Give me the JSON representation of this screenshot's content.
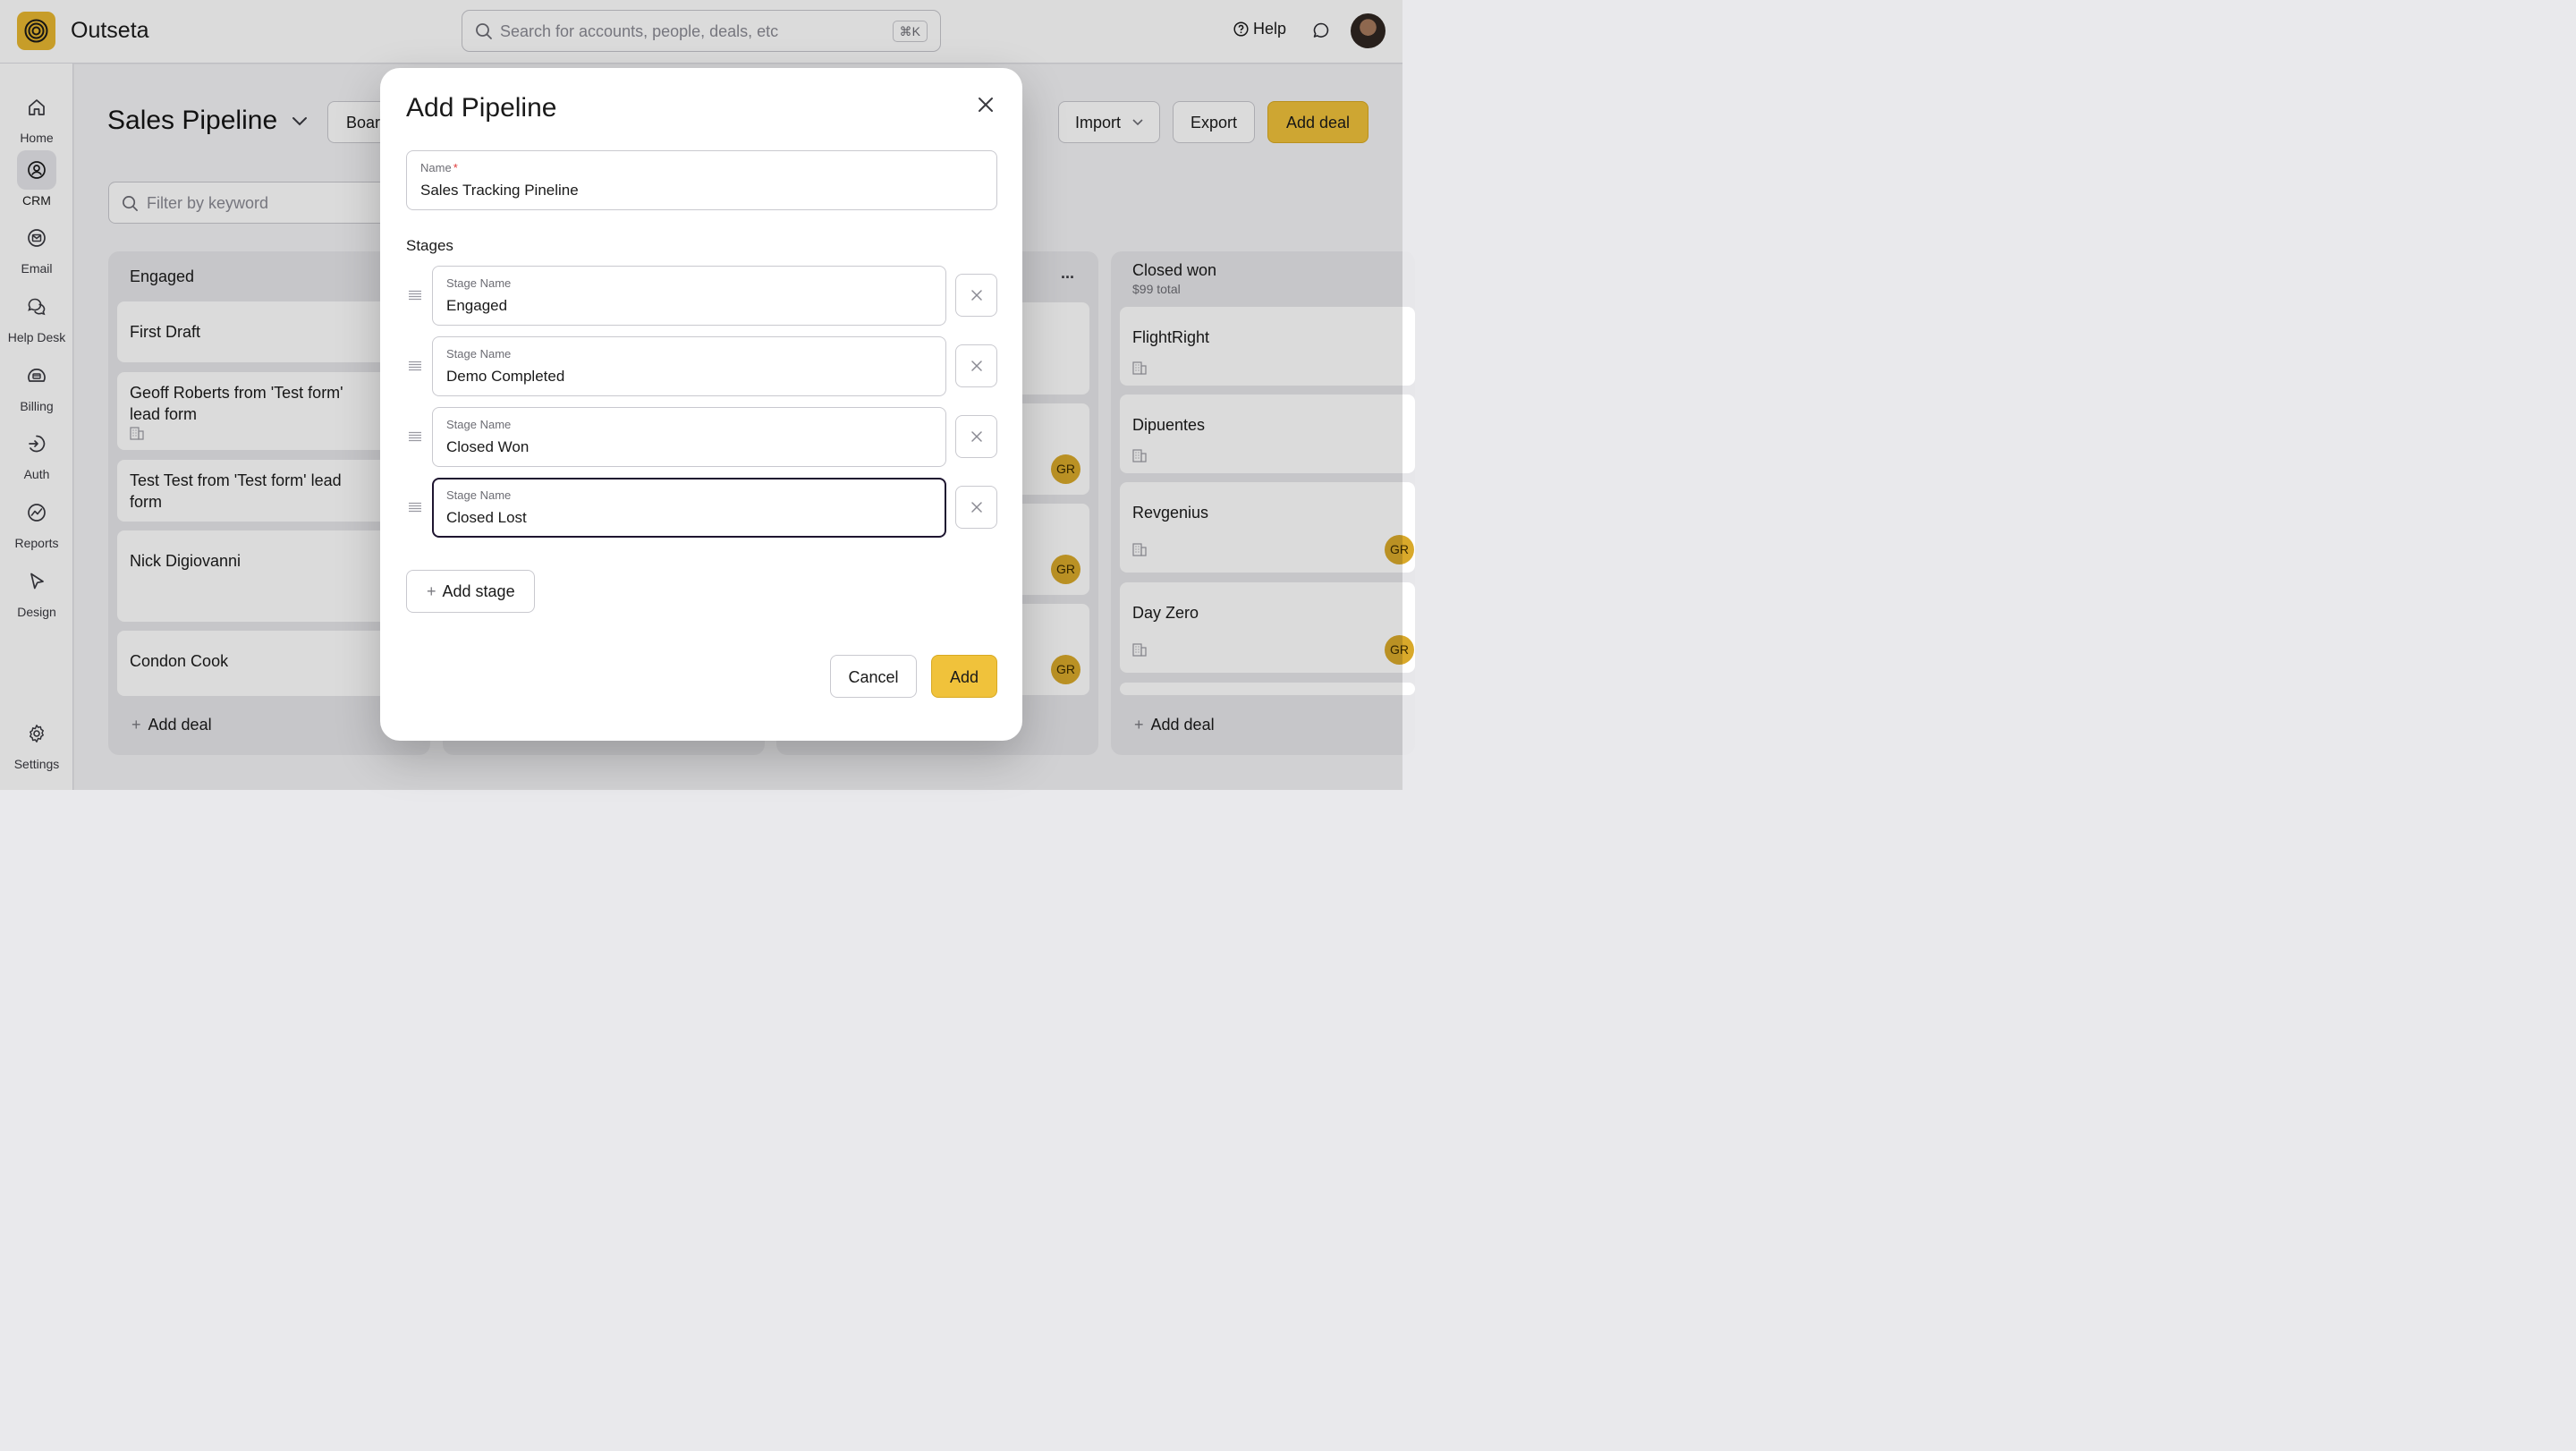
{
  "app": {
    "brand": "Outseta"
  },
  "topbar": {
    "search_placeholder": "Search for accounts, people, deals, etc",
    "search_shortcut": "⌘K",
    "help_label": "Help"
  },
  "sidebar": {
    "items": [
      {
        "label": "Home",
        "icon": "home-icon"
      },
      {
        "label": "CRM",
        "icon": "crm-icon",
        "active": true
      },
      {
        "label": "Email",
        "icon": "email-icon"
      },
      {
        "label": "Help Desk",
        "icon": "help-desk-icon"
      },
      {
        "label": "Billing",
        "icon": "billing-icon"
      },
      {
        "label": "Auth",
        "icon": "auth-icon"
      },
      {
        "label": "Reports",
        "icon": "reports-icon"
      },
      {
        "label": "Design",
        "icon": "design-icon"
      },
      {
        "label": "Settings",
        "icon": "settings-icon"
      }
    ]
  },
  "page": {
    "title": "Sales Pipeline",
    "view_button": "Boar",
    "import_label": "Import",
    "export_label": "Export",
    "add_deal_label": "Add deal",
    "filter_placeholder": "Filter by keyword"
  },
  "board": {
    "engaged": {
      "title": "Engaged",
      "cards": [
        "First Draft",
        "Geoff Roberts from 'Test form' lead form",
        "Test Test from 'Test form' lead form",
        "Nick Digiovanni",
        "Condon Cook"
      ],
      "add_deal": "Add deal"
    },
    "middle": {
      "owner_initials": "GR",
      "menu": "..."
    },
    "closed_won": {
      "title": "Closed won",
      "subtitle": "$99 total",
      "cards": [
        "FlightRight",
        "Dipuentes",
        "Revgenius",
        "Day Zero"
      ],
      "add_deal": "Add deal",
      "owner_initials": "GR"
    }
  },
  "modal": {
    "title": "Add Pipeline",
    "name_label": "Name",
    "required_mark": "*",
    "name_value": "Sales Tracking Pineline",
    "stages_label": "Stages",
    "stage_field_label": "Stage Name",
    "stages": [
      "Engaged",
      "Demo Completed",
      "Closed Won",
      "Closed Lost"
    ],
    "add_stage_label": "Add stage",
    "cancel_label": "Cancel",
    "add_label": "Add"
  },
  "colors": {
    "accent": "#f0c23b",
    "avatar_badge": "#d9a92a",
    "focus_border": "#1e1530"
  }
}
